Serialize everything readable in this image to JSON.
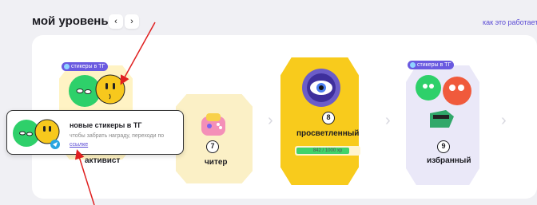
{
  "header": {
    "title": "мой уровень",
    "prev_icon": "chevron-left-icon",
    "prev_glyph": "‹",
    "next_icon": "chevron-right-icon",
    "next_glyph": "›",
    "how_link": "как это работает"
  },
  "levels": [
    {
      "name": "активист",
      "tag": "стикеры в ТГ"
    },
    {
      "name": "читер",
      "number": "7"
    },
    {
      "name": "просветленный",
      "number": "8",
      "progress_text": "842 / 1000 хр",
      "progress_value": 0.842
    },
    {
      "name": "избранный",
      "number": "9",
      "tag": "стикеры в ТГ"
    }
  ],
  "tooltip": {
    "title": "новые стикеры в ТГ",
    "desc": "чтобы забрать награду, переходи по",
    "link": "ссылке"
  },
  "colors": {
    "accent": "#6a5ae0",
    "gold": "#f8cb1c",
    "progress": "#41d36b",
    "annotation_arrow": "#e02020"
  }
}
